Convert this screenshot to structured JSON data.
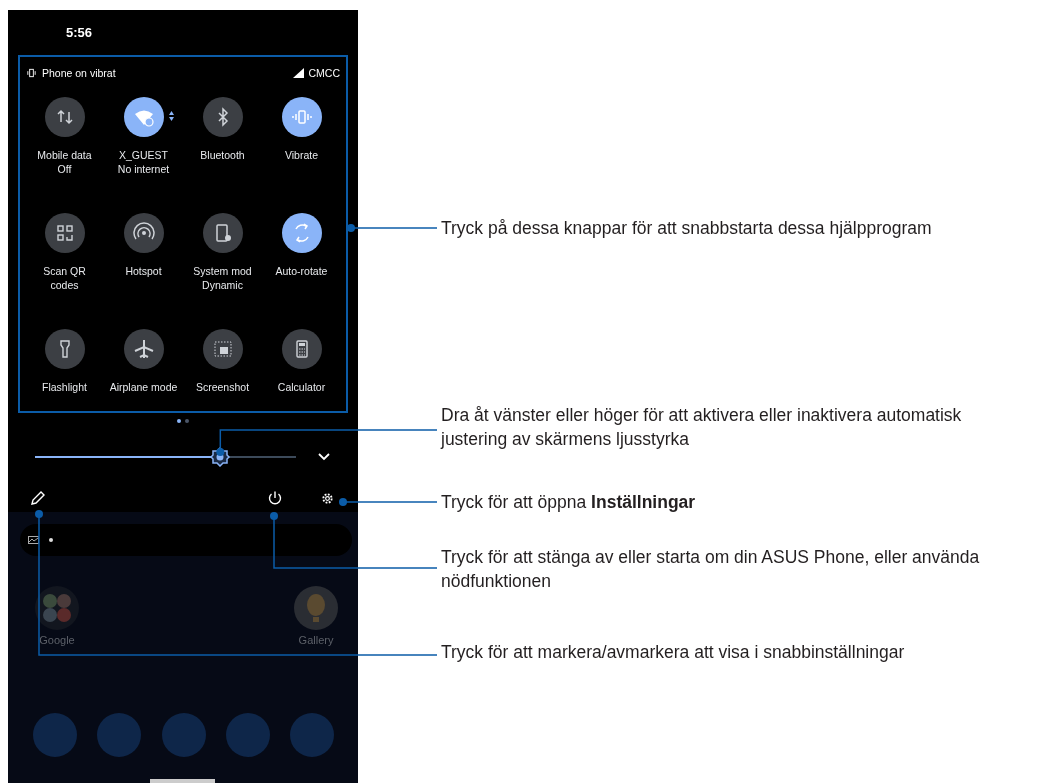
{
  "status_bar": {
    "time": "5:56"
  },
  "quick_settings": {
    "notice": "Phone on vibrat",
    "carrier": "CMCC",
    "tiles": [
      {
        "label": "Mobile data",
        "status": "Off",
        "on": false
      },
      {
        "label": "X_GUEST",
        "status": "No internet",
        "on": true
      },
      {
        "label": "Bluetooth",
        "on": false
      },
      {
        "label": "Vibrate",
        "on": true
      },
      {
        "label": "Scan QR codes",
        "on": false
      },
      {
        "label": "Hotspot",
        "on": false
      },
      {
        "label": "System mod",
        "status": "Dynamic",
        "on": false
      },
      {
        "label": "Auto-rotate",
        "on": true
      },
      {
        "label": "Flashlight",
        "on": false
      },
      {
        "label": "Airplane mode",
        "on": false
      },
      {
        "label": "Screenshot",
        "on": false
      },
      {
        "label": "Calculator",
        "on": false
      }
    ],
    "pages": [
      {
        "selected": true
      },
      {
        "selected": false
      }
    ]
  },
  "brightness": {
    "level": 0.71
  },
  "home_screen": {
    "apps": [
      {
        "label": "Google"
      },
      {
        "label": "Gallery"
      }
    ]
  },
  "callouts": [
    {
      "text": "Tryck på dessa knappar för att snabbstarta dessa hjälpprogram"
    },
    {
      "text": "Dra åt vänster eller höger för att aktivera eller inaktivera automatisk justering av skärmens ljusstyrka"
    },
    {
      "text": "Tryck för att öppna **Inställningar**"
    },
    {
      "text": "Tryck för att stänga av eller starta om din ASUS Phone, eller använda nödfunktionen"
    },
    {
      "text": "Tryck för att markera/avmarkera att visa i snabbinställningar"
    }
  ]
}
